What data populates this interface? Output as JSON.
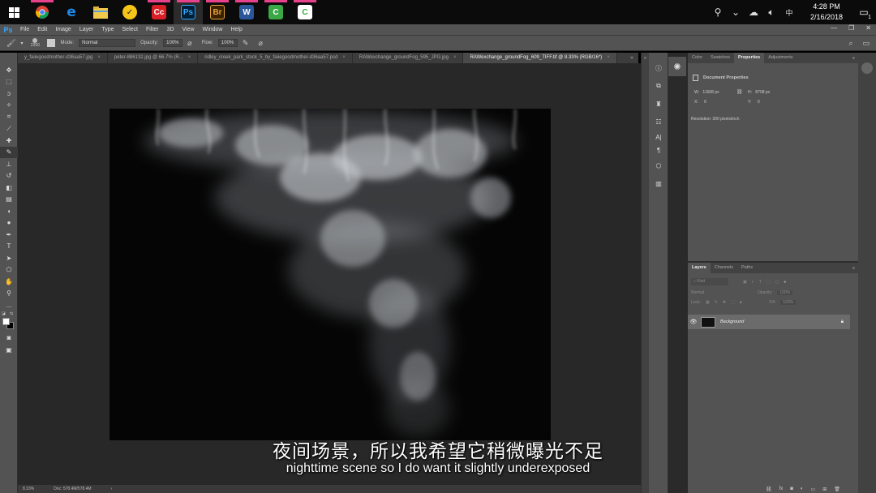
{
  "taskbar": {
    "apps": [
      {
        "name": "chrome",
        "label": "",
        "color": "#e53935",
        "open": true
      },
      {
        "name": "edge",
        "label": "e",
        "color": "#1e88e5",
        "open": false
      },
      {
        "name": "file-explorer",
        "label": "",
        "color": "#f2c94c",
        "open": false
      },
      {
        "name": "norton",
        "label": "✓",
        "color": "#f5c518",
        "open": false
      },
      {
        "name": "creative-cloud",
        "label": "Cc",
        "color": "#da1f26",
        "open": true
      },
      {
        "name": "photoshop",
        "label": "Ps",
        "color": "#001e36",
        "open": true,
        "active": true
      },
      {
        "name": "bridge",
        "label": "Br",
        "color": "#3a2200",
        "open": true
      },
      {
        "name": "word",
        "label": "W",
        "color": "#2b579a",
        "open": true
      },
      {
        "name": "camtasia",
        "label": "C",
        "color": "#3aa845",
        "open": true
      },
      {
        "name": "camtasia-recorder",
        "label": "C",
        "color": "#ffffff",
        "open": true
      }
    ],
    "time": "4:28 PM",
    "date": "2/16/2018",
    "notification_count": "1"
  },
  "menubar": {
    "logo": "Ps",
    "items": [
      "File",
      "Edit",
      "Image",
      "Layer",
      "Type",
      "Select",
      "Filter",
      "3D",
      "View",
      "Window",
      "Help"
    ]
  },
  "options": {
    "brush_size": "2300",
    "mode_label": "Mode:",
    "mode_value": "Normal",
    "opacity_label": "Opacity:",
    "opacity_value": "100%",
    "flow_label": "Flow:",
    "flow_value": "100%"
  },
  "tabs": [
    {
      "label": "y_faiiegoodmother-d36aa57.jpg",
      "active": false
    },
    {
      "label": "peter-886132.jpg @ 66.7% (R...",
      "active": false
    },
    {
      "label": "ridley_creek_park_stock_5_by_faiiegoodmother-d36aa57.psd",
      "active": false
    },
    {
      "label": "RAWexchange_groundFog_595_JPG.jpg",
      "active": false
    },
    {
      "label": "RAWexchange_groundFog_609_TIFF.tif @ 8.33% (RGB/16*)",
      "active": true
    }
  ],
  "status": {
    "zoom": "8.33%",
    "doc": "Doc: 578.4M/578.4M",
    "arrow": "›"
  },
  "properties_panel": {
    "tabs": [
      "Color",
      "Swatches",
      "Properties",
      "Adjustments"
    ],
    "active_tab": "Properties",
    "title": "Document Properties",
    "w_label": "W:",
    "w_value": "11608 px",
    "h_label": "H:",
    "h_value": "8708 px",
    "x_label": "X:",
    "x_value": "0",
    "y_label": "Y:",
    "y_value": "0",
    "resolution": "Resolution: 300 pixels/inch"
  },
  "layers_panel": {
    "tabs": [
      "Layers",
      "Channels",
      "Paths"
    ],
    "active_tab": "Layers",
    "filter_placeholder": "Kind",
    "blend_mode": "Normal",
    "opacity_label": "Opacity:",
    "opacity_value": "100%",
    "lock_label": "Lock:",
    "fill_label": "Fill:",
    "fill_value": "100%",
    "layers": [
      {
        "name": "Background",
        "visible": true,
        "locked": true
      }
    ]
  },
  "subtitles": {
    "chinese": "夜间场景，所以我希望它稍微曝光不足",
    "english": "nighttime scene so I do want it slightly underexposed"
  }
}
